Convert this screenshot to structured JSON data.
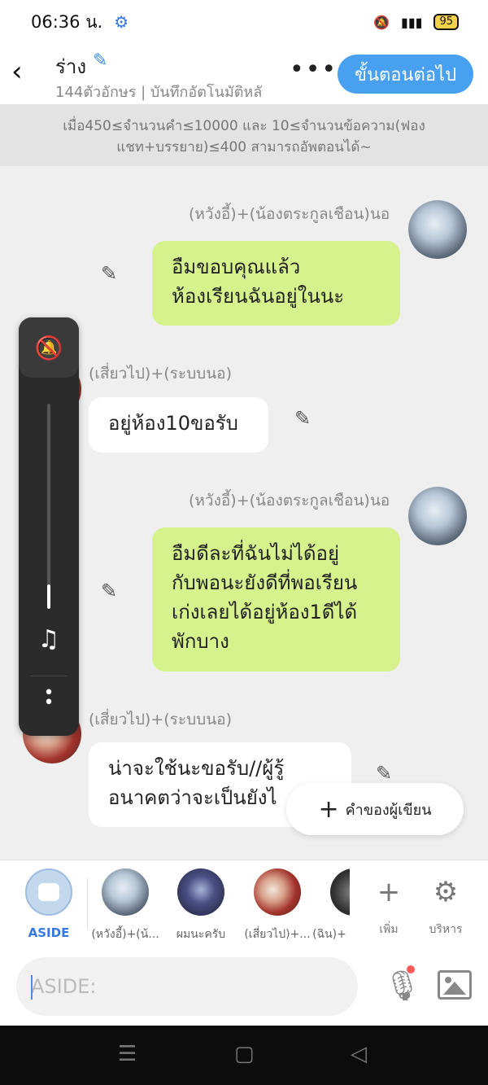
{
  "status": {
    "time": "06:36 น.",
    "battery": "95"
  },
  "header": {
    "title": "ร่าง",
    "subtitle": "144ตัวอักษร | บันทึกอัตโนมัติหลั",
    "next_label": "ขั้นตอนต่อไป"
  },
  "notice": "เมื่อ450≤จำนวนคำ≤10000 และ 10≤จำนวนข้อความ(ฟองแชท+บรรยาย)≤400 สามารถอัพตอนได้~",
  "messages": [
    {
      "name": "(หวังอี้)+(น้องตระกูลเชือน)นอ",
      "text": "อืมขอบคุณแล้ว\nห้องเรียนฉันอยู่ในนะ"
    },
    {
      "name": "(เสี่ยวไป)+(ระบบนอ)",
      "text": "อยู่ห้อง10ขอรับ"
    },
    {
      "name": "(หวังอี้)+(น้องตระกูลเชือน)นอ",
      "text": "อืมดีละที่ฉันไม่ได้อยู่\nกับพอนะยังดีที่พอเรียน\nเก่งเลยได้อยู่ห้อง1ดีได้\nพักบาง"
    },
    {
      "name": "(เสี่ยวไป)+(ระบบนอ)",
      "text": "น่าจะใช้นะขอรับ//ผู้รู้\nอนาคตว่าจะเป็นยังไ"
    }
  ],
  "author_button": "คำของผู้เขียน",
  "characters": [
    {
      "label": "ASIDE"
    },
    {
      "label": "(หวังอี้)+(น้..."
    },
    {
      "label": "ผมนะครับ"
    },
    {
      "label": "(เสี่ยวไป)+..."
    },
    {
      "label": "(ฉิน)+"
    }
  ],
  "actions": {
    "add": "เพิ่ม",
    "manage": "บริหาร"
  },
  "input": {
    "placeholder": "ASIDE:"
  }
}
